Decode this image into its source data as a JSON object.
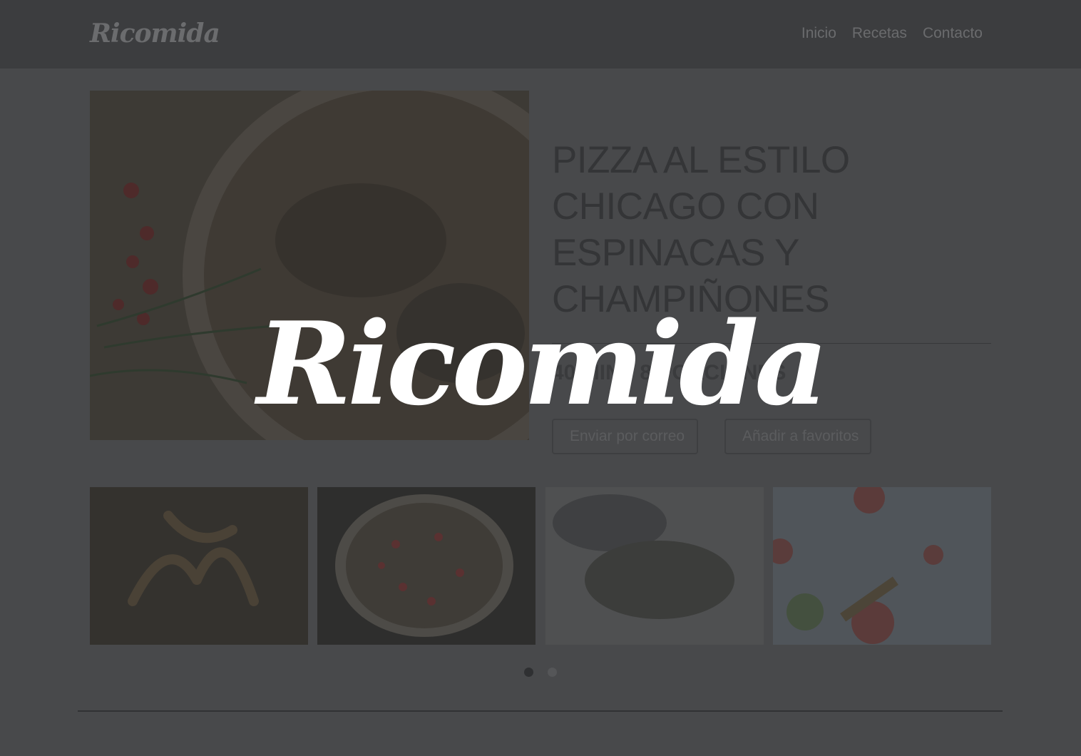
{
  "navbar": {
    "brand": "Ricomida",
    "links": [
      "Inicio",
      "Recetas",
      "Contacto"
    ]
  },
  "recipe": {
    "title_lines": [
      "PIZZA AL ESTILO",
      "CHICAGO CON",
      "ESPINACAS Y",
      "CHAMPIÑONES"
    ],
    "meta": "40 MIN · 8 PORCIONES",
    "image_icon": "pizza-photo",
    "buttons": {
      "email": "Enviar por correo",
      "favorite": "Añadir a favoritos"
    }
  },
  "gallery": {
    "thumbnails": [
      "pastry-photo",
      "pizza-photo",
      "dough-photo",
      "pizza-slices-photo"
    ],
    "dots": [
      "active",
      "inactive"
    ]
  },
  "splash": {
    "logo": "Ricomida"
  }
}
